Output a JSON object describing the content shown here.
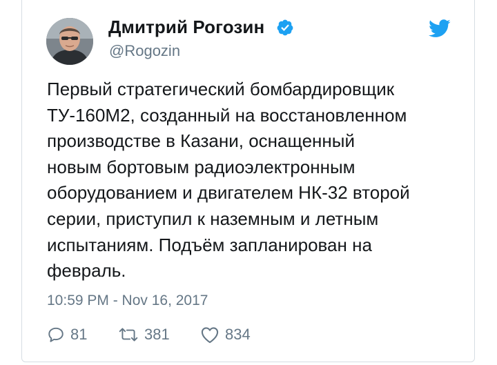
{
  "author": {
    "display_name": "Дмитрий Рогозин",
    "handle": "@Rogozin",
    "verified": true,
    "avatar_icon": "profile-photo"
  },
  "brand": {
    "logo_icon": "twitter-bird-icon",
    "color": "#1da1f2"
  },
  "tweet": {
    "lines": [
      "Первый стратегический бомбардировщик",
      "ТУ-160М2, созданный на восстановленном",
      "производстве в Казани, оснащенный",
      "новым бортовым радиоэлектронным",
      "оборудованием и двигателем НК-32 второй",
      "серии, приступил к наземным и летным",
      "испытаниям. Подъём запланирован на",
      "февраль."
    ],
    "timestamp": "10:59 PM - Nov 16, 2017"
  },
  "actions": {
    "reply": {
      "icon": "reply-bubble-icon",
      "count": "81"
    },
    "retweet": {
      "icon": "retweet-icon",
      "count": "381"
    },
    "like": {
      "icon": "heart-icon",
      "count": "834"
    }
  },
  "colors": {
    "text": "#14171a",
    "secondary": "#657786",
    "border": "#d6dde3"
  }
}
